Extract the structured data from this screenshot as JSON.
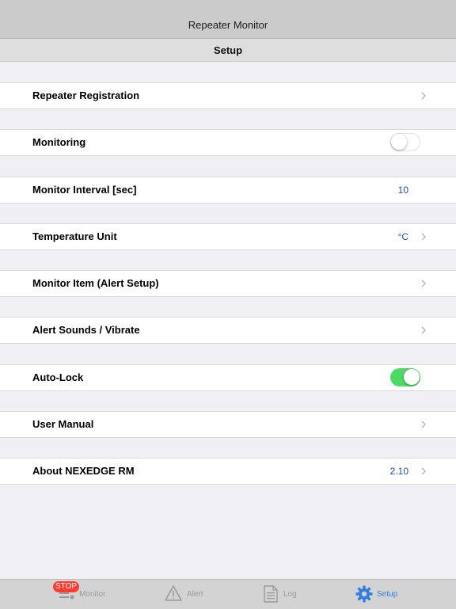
{
  "nav": {
    "title": "Repeater Monitor"
  },
  "subbar": {
    "title": "Setup"
  },
  "rows": [
    {
      "label": "Repeater Registration"
    },
    {
      "label": "Monitoring",
      "toggle": "off"
    },
    {
      "label": "Monitor Interval [sec]",
      "value": "10"
    },
    {
      "label": "Temperature Unit",
      "value": "°C"
    },
    {
      "label": "Monitor Item (Alert Setup)"
    },
    {
      "label": "Alert Sounds / Vibrate"
    },
    {
      "label": "Auto-Lock",
      "toggle": "on"
    },
    {
      "label": "User Manual"
    },
    {
      "label": "About NEXEDGE RM",
      "value": "2.10"
    }
  ],
  "tabbar": {
    "stop_badge": "STOP",
    "tabs": [
      {
        "label": "Monitor",
        "icon": "monitor-icon"
      },
      {
        "label": "Alert",
        "icon": "alert-icon"
      },
      {
        "label": "Log",
        "icon": "log-icon"
      },
      {
        "label": "Setup",
        "icon": "gear-icon",
        "active": true
      }
    ]
  },
  "colors": {
    "accent": "#2f7de1",
    "toggle_on": "#4cd964",
    "badge": "#ff3b30",
    "value_text": "#1f4fa8"
  }
}
